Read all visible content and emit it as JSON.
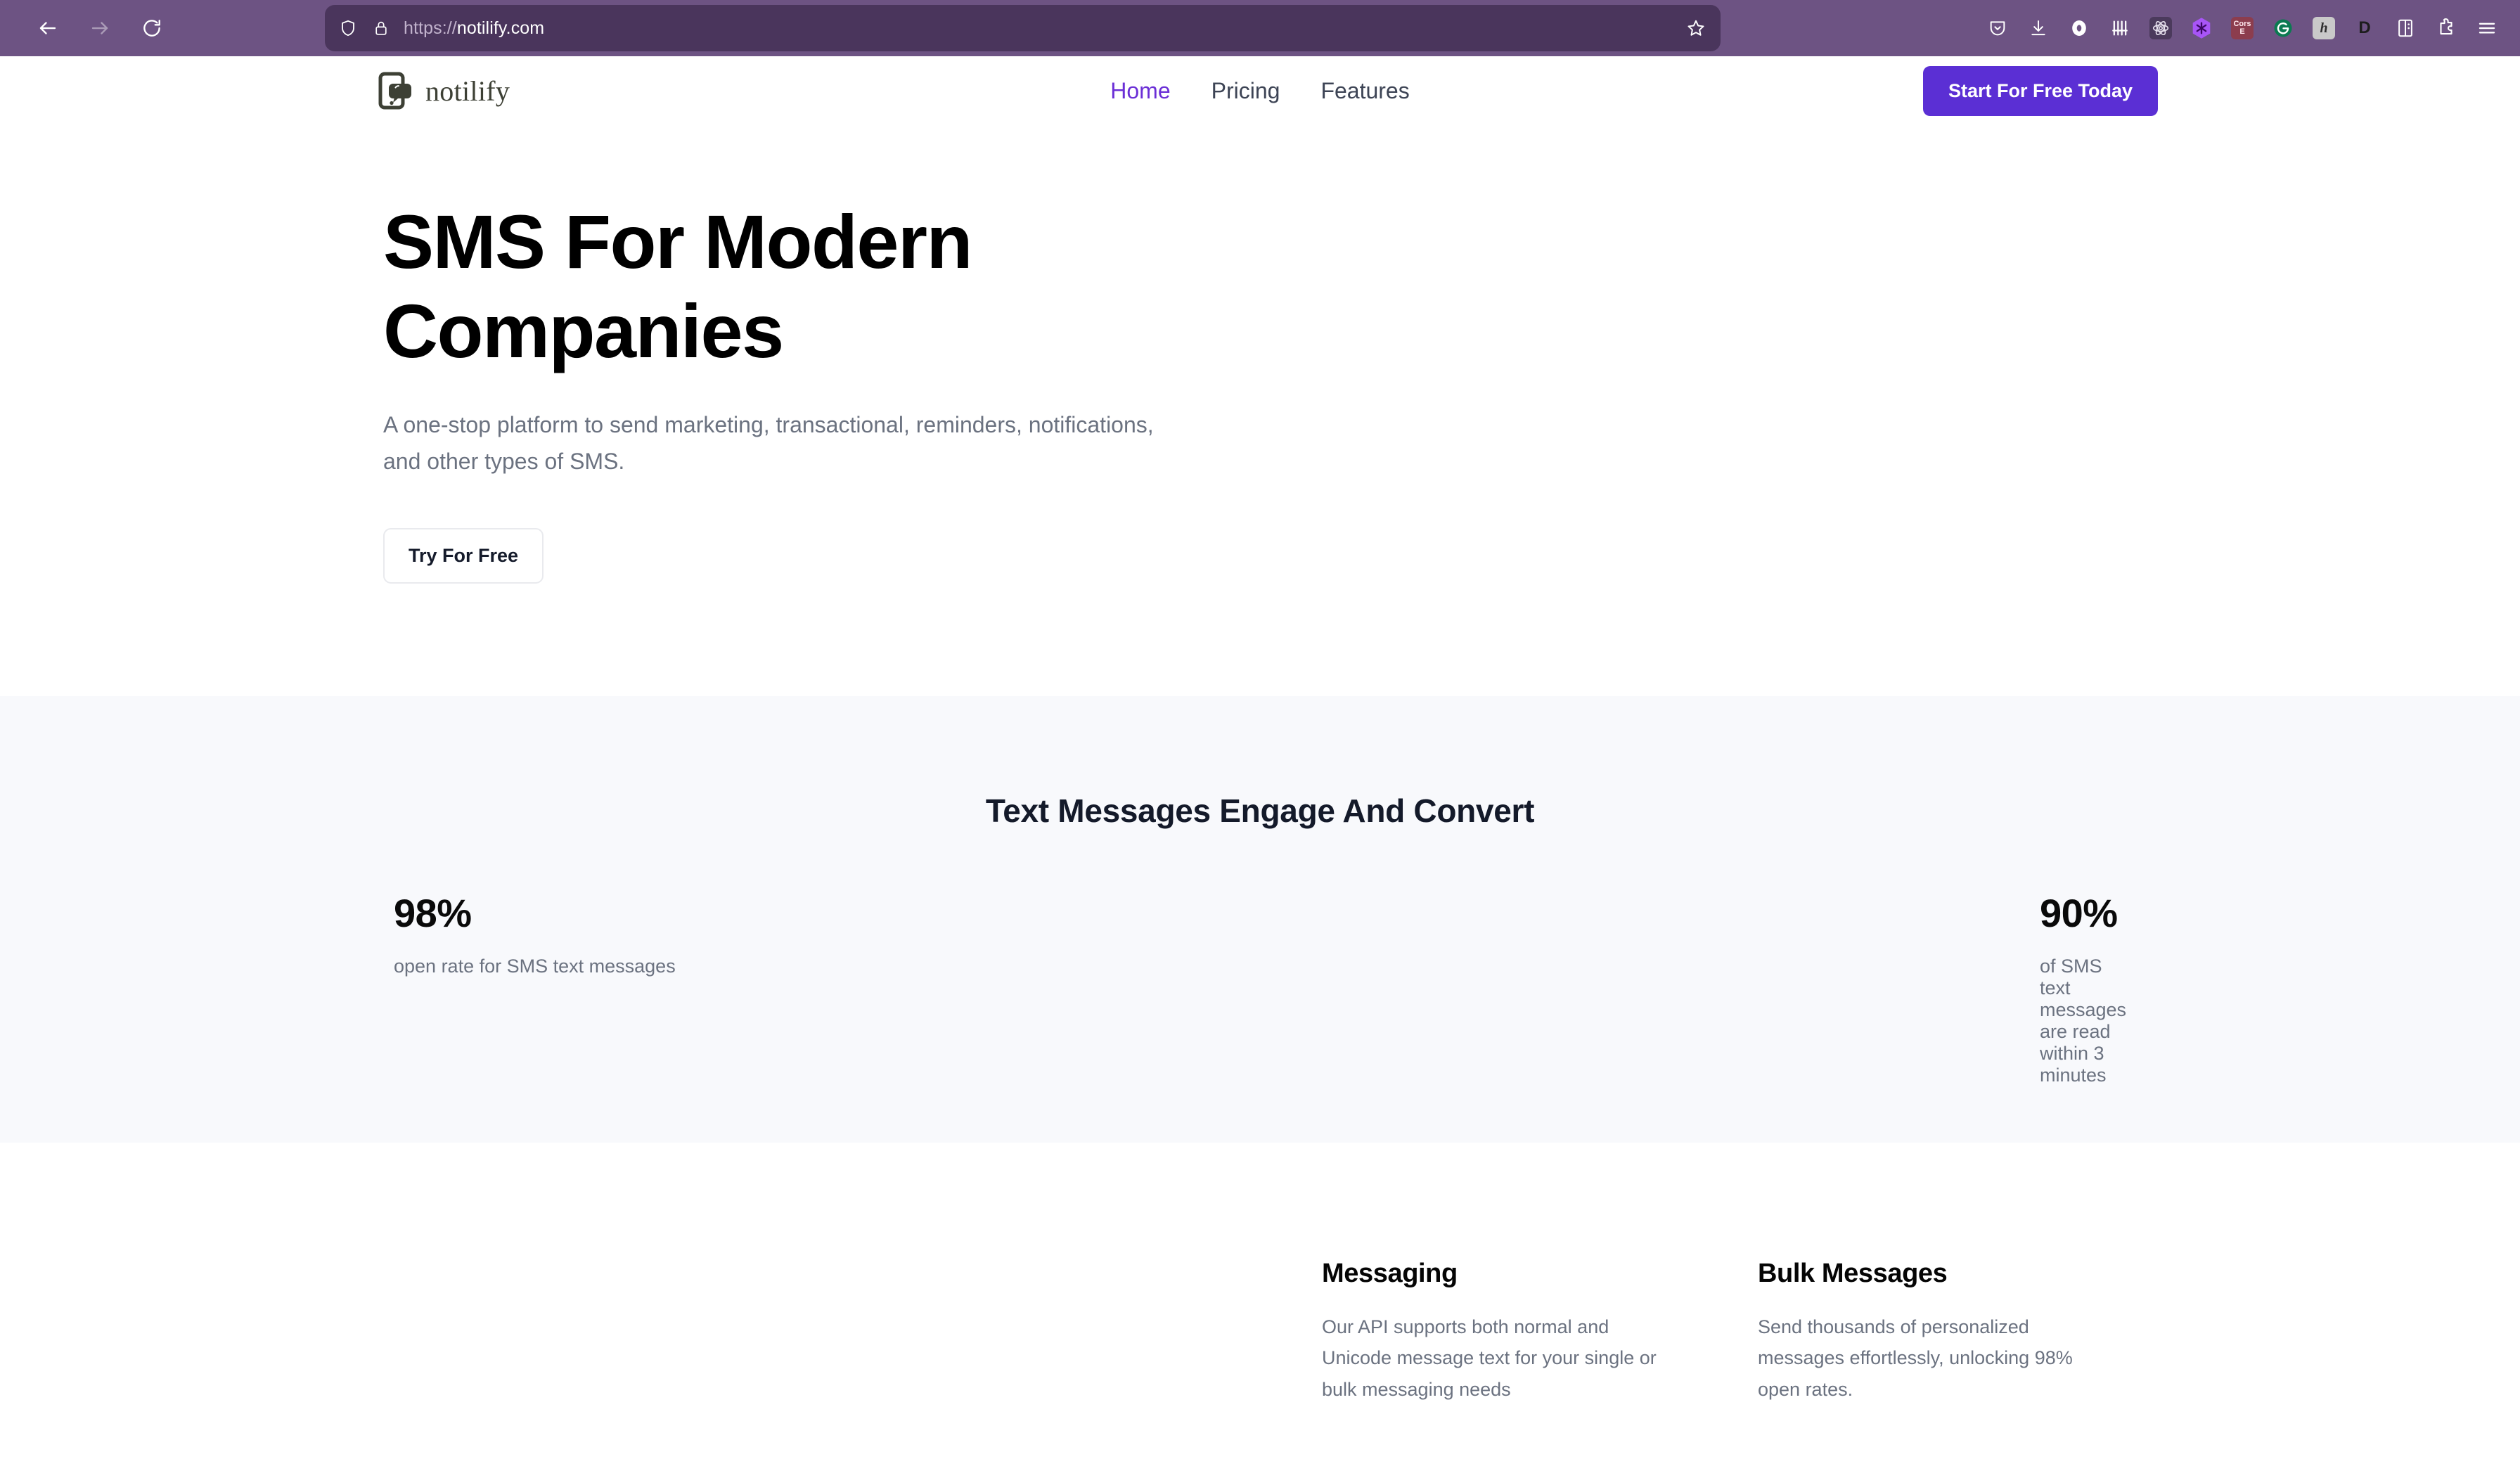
{
  "browser": {
    "back_icon": "back-arrow-icon",
    "forward_icon": "forward-arrow-icon",
    "reload_icon": "reload-icon",
    "shield_icon": "shield-icon",
    "lock_icon": "padlock-icon",
    "star_icon": "star-icon",
    "url_scheme": "https://",
    "url_host": "notilify.com",
    "url_full": "https://notilify.com",
    "extensions": [
      {
        "name": "pocket-icon",
        "label": "",
        "bg": "transparent",
        "fg": "#ffffff"
      },
      {
        "name": "downloads-icon",
        "label": "",
        "bg": "transparent",
        "fg": "#ffffff"
      },
      {
        "name": "zero-ring-icon",
        "label": "",
        "bg": "transparent",
        "fg": "#ffffff"
      },
      {
        "name": "comb-bars-icon",
        "label": "",
        "bg": "transparent",
        "fg": "#ffffff"
      },
      {
        "name": "react-devtools-icon",
        "label": "",
        "bg": "#4b3a5c",
        "fg": "#e8e3ef"
      },
      {
        "name": "hexagon-asterisk-icon",
        "label": "",
        "bg": "#a855f7",
        "fg": "#3b0764"
      },
      {
        "name": "cors-extension-icon",
        "label": "Cors E",
        "bg": "#8c3d4e",
        "fg": "#ffe9ef"
      },
      {
        "name": "grammarly-icon",
        "label": "G",
        "bg": "#0b7a51",
        "fg": "#ffffff"
      },
      {
        "name": "honey-icon",
        "label": "h",
        "bg": "#c9c9c9",
        "fg": "#2f2f2f"
      },
      {
        "name": "dashlane-icon",
        "label": "D",
        "bg": "#d9d9d9",
        "fg": "#1a1a1a"
      },
      {
        "name": "screenshot-icon",
        "label": "",
        "bg": "transparent",
        "fg": "#ffffff"
      },
      {
        "name": "extensions-puzzle-icon",
        "label": "",
        "bg": "transparent",
        "fg": "#ffffff"
      },
      {
        "name": "app-menu-icon",
        "label": "",
        "bg": "transparent",
        "fg": "#ffffff"
      }
    ]
  },
  "site": {
    "brand_name": "notilify",
    "brand_mark": "phone-message-logo-icon",
    "nav": [
      {
        "label": "Home",
        "active": true
      },
      {
        "label": "Pricing",
        "active": false
      },
      {
        "label": "Features",
        "active": false
      }
    ],
    "cta_label": "Start For Free Today",
    "accent_color": "#5b2fd4",
    "active_nav_color": "#6b2fd6"
  },
  "hero": {
    "title_line1": "SMS For Modern",
    "title_line2": "Companies",
    "subtitle": "A one-stop platform to send marketing, transactional, reminders, notifications, and other types of SMS.",
    "button_label": "Try For Free"
  },
  "stats": {
    "heading": "Text Messages Engage And Convert",
    "background_color": "#f8f9fc",
    "items": [
      {
        "value": "98%",
        "label": "open rate for SMS text messages"
      },
      {
        "value": "90%",
        "label": "of SMS text messages are read within 3 minutes"
      }
    ]
  },
  "features": {
    "cards": [
      {
        "title": "Messaging",
        "body": "Our API supports both normal and Unicode message text for your single or bulk messaging needs"
      },
      {
        "title": "Bulk Messages",
        "body": "Send thousands of personalized messages effortlessly, unlocking 98% open rates."
      }
    ]
  }
}
